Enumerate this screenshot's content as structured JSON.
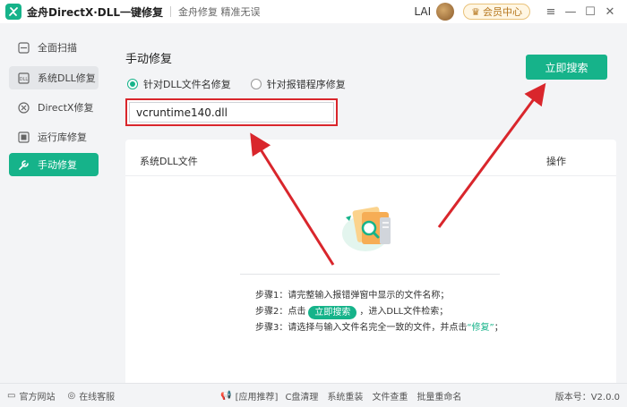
{
  "titlebar": {
    "app_title": "金舟DirectX·DLL一键修复",
    "slogan": "金舟修复 精准无误",
    "user_name": "LAI",
    "member_label": "会员中心",
    "controls": [
      "≡",
      "—",
      "☐",
      "✕"
    ]
  },
  "sidebar": {
    "items": [
      {
        "label": "全面扫描",
        "icon": "scan-icon",
        "state": "normal"
      },
      {
        "label": "系统DLL修复",
        "icon": "dll-icon",
        "state": "hover"
      },
      {
        "label": "DirectX修复",
        "icon": "directx-icon",
        "state": "normal"
      },
      {
        "label": "运行库修复",
        "icon": "runtime-icon",
        "state": "normal"
      },
      {
        "label": "手动修复",
        "icon": "wrench-icon",
        "state": "active"
      }
    ]
  },
  "main": {
    "title": "手动修复",
    "radio_options": [
      {
        "label": "针对DLL文件名修复",
        "checked": true
      },
      {
        "label": "针对报错程序修复",
        "checked": false
      }
    ],
    "search_value": "vcruntime140.dll",
    "search_button": "立即搜索",
    "table": {
      "col_file": "系统DLL文件",
      "col_action": "操作"
    },
    "steps": {
      "step1": "步骤1：请完整输入报错弹窗中显示的文件名称；",
      "step2_prefix": "步骤2：点击",
      "step2_button": "立即搜索",
      "step2_suffix": "，进入DLL文件检索；",
      "step3_prefix": "步骤3：请选择与输入文件名完全一致的文件，并点击",
      "step3_link": "“修复”",
      "step3_suffix": "；"
    }
  },
  "footer": {
    "website": "官方网站",
    "service": "在线客服",
    "recommend": "[应用推荐]",
    "links": [
      "C盘清理",
      "系统重装",
      "文件查重",
      "批量重命名"
    ],
    "version": "版本号：V2.0.0"
  },
  "colors": {
    "accent": "#16b38a",
    "annotation": "#d9262c",
    "background": "#f3f4f6"
  }
}
